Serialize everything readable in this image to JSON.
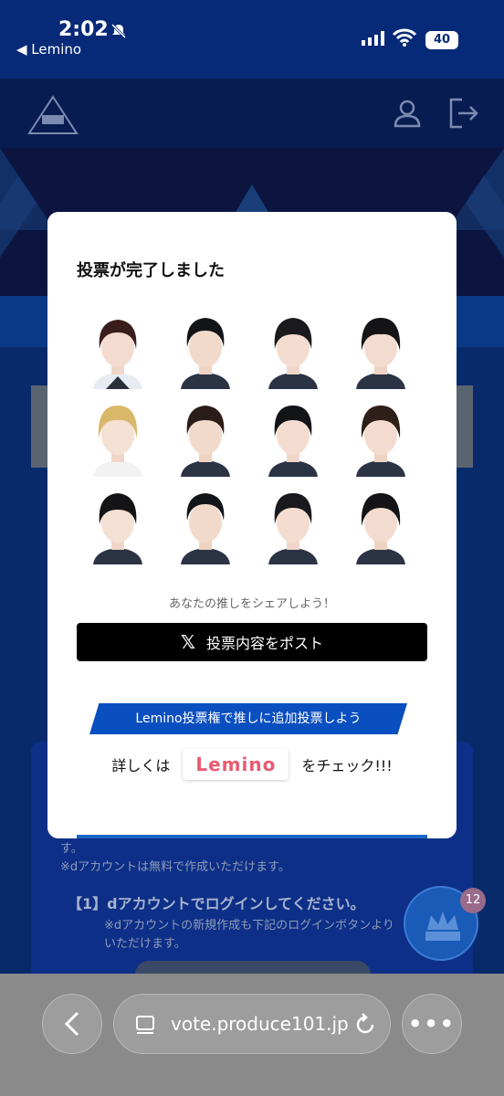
{
  "status_bar": {
    "time": "2:02",
    "back_app": "◀ Lemino",
    "battery": "40"
  },
  "modal": {
    "title": "投票が完了しました",
    "share_text": "あなたの推しをシェアしよう！",
    "post_button_label": "投票内容をポスト",
    "x_icon_glyph": "𝕏",
    "promo_ribbon": "Lemino投票権で推しに追加投票しよう",
    "promo_prefix": "詳しくは",
    "lemino_logo": "Lemino",
    "promo_suffix": "をチェック!!!"
  },
  "background": {
    "text1": "す。",
    "text2": "※dアカウントは無料で作成いただけます。",
    "text3": "【1】dアカウントでログインしてください。",
    "text4": "※dアカウントの新規作成も下記のログインボタンより",
    "text5": "いただけます。",
    "fab_badge": "12"
  },
  "browser": {
    "url": "vote.produce101.jp",
    "more_glyph": "•••"
  },
  "colors": {
    "accent": "#0a4fc0",
    "post_button": "#000000",
    "promo_bg": "#cfe3fb",
    "lemino": "#e95a72"
  }
}
